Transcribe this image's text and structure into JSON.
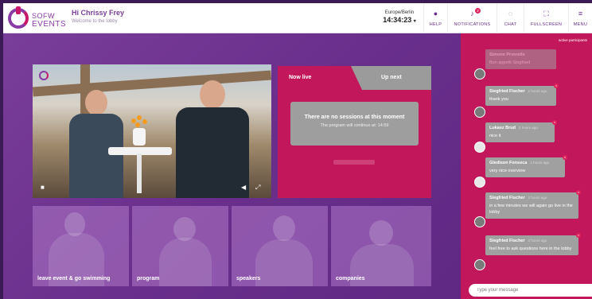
{
  "header": {
    "logo_line1": "SOFW",
    "logo_line2": "EVENTS",
    "greeting": "Hi Chrissy Frey",
    "subtitle": "Welcome to the lobby",
    "timezone": "Europe/Berlin",
    "time": "14:34:23",
    "nav": [
      {
        "label": "HELP",
        "icon": "help-icon"
      },
      {
        "label": "NOTIFICATIONS",
        "icon": "bell-icon",
        "badge": "2"
      },
      {
        "label": "CHAT",
        "icon": "chat-icon"
      },
      {
        "label": "FULLSCREEN",
        "icon": "fullscreen-icon"
      },
      {
        "label": "MENU",
        "icon": "menu-icon"
      }
    ]
  },
  "sessions": {
    "tab_now": "Now live",
    "tab_next": "Up next",
    "empty_title": "There are no sessions at this moment",
    "empty_sub": "The program will continue at: 14:59"
  },
  "tiles": [
    {
      "label": "leave event & go swimming"
    },
    {
      "label": "program"
    },
    {
      "label": "speakers"
    },
    {
      "label": "companies"
    }
  ],
  "chat": {
    "active_label": "active participants",
    "messages": [
      {
        "name": "Simone Prverelle",
        "time": "",
        "text": "Bon appetit Siegfried"
      },
      {
        "name": "Siegfried Fischer",
        "time": "2 hours ago",
        "text": "thank you"
      },
      {
        "name": "Lukasz Brud",
        "time": "2 hours ago",
        "text": "nice it"
      },
      {
        "name": "Gledison Fonseca",
        "time": "2 hours ago",
        "text": "very nice overview"
      },
      {
        "name": "Siegfried Fischer",
        "time": "2 hours ago",
        "text": "in a few minutes we will again go live in the lobby"
      },
      {
        "name": "Siegfried Fischer",
        "time": "2 hours ago",
        "text": "feel free to ask questions here in the lobby"
      }
    ],
    "placeholder": "Type your message"
  },
  "colors": {
    "accent": "#c2185b",
    "brand_purple": "#7a3f9a",
    "background": "#6a2f8c"
  }
}
